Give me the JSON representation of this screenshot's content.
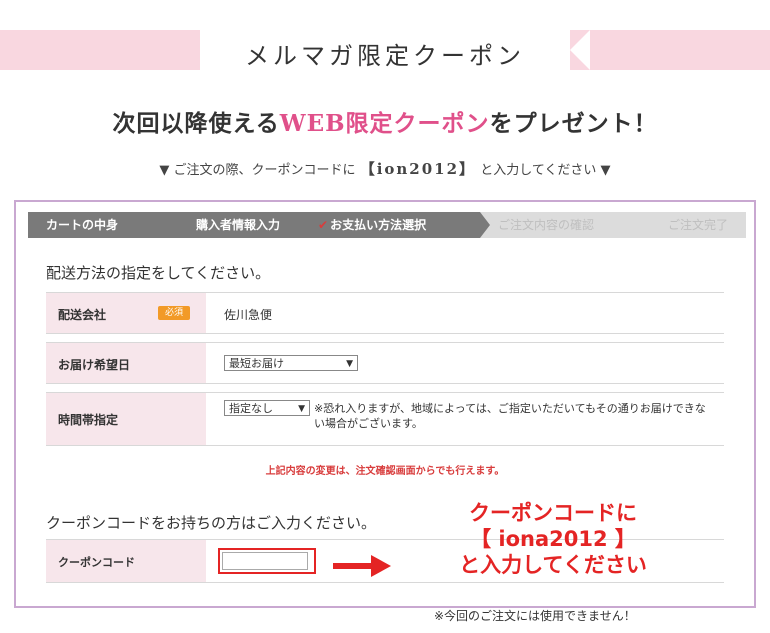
{
  "banner": {
    "title": "メルマガ限定クーポン"
  },
  "headline": {
    "before": "次回以降使える",
    "accent": "WEB限定クーポン",
    "after": "をプレゼント！"
  },
  "instruction": {
    "prefix": "▼ ご注文の際、クーポンコードに",
    "code": "【ion2012】",
    "suffix": "と入力してください ▼"
  },
  "steps": [
    {
      "label": "カートの中身"
    },
    {
      "label": "購入者情報入力"
    },
    {
      "label": "お支払い方法選択"
    },
    {
      "label": "ご注文内容の確認"
    },
    {
      "label": "ご注文完了"
    }
  ],
  "delivery": {
    "section_title": "配送方法の指定をしてください。",
    "carrier": {
      "label": "配送会社",
      "required_badge": "必須",
      "value": "佐川急便"
    },
    "date": {
      "label": "お届け希望日",
      "selected": "最短お届け"
    },
    "time": {
      "label": "時間帯指定",
      "selected": "指定なし",
      "note": "※恐れ入りますが、地域によっては、ご指定いただいてもその通りお届けできない場合がございます。"
    },
    "change_note": "上記内容の変更は、注文確認画面からでも行えます。"
  },
  "coupon": {
    "section_title": "クーポンコードをお持ちの方はご入力ください。",
    "label": "クーポンコード",
    "value": ""
  },
  "callout": {
    "line1": "クーポンコードに",
    "line2": "【 iona2012 】",
    "line3": "と入力してください"
  },
  "footnote": "※今回のご注文には使用できません！",
  "colors": {
    "accent_pink": "#e0508a",
    "alert_red": "#e42424",
    "frame_purple": "#c9a8d1",
    "required_orange": "#f29a27"
  }
}
